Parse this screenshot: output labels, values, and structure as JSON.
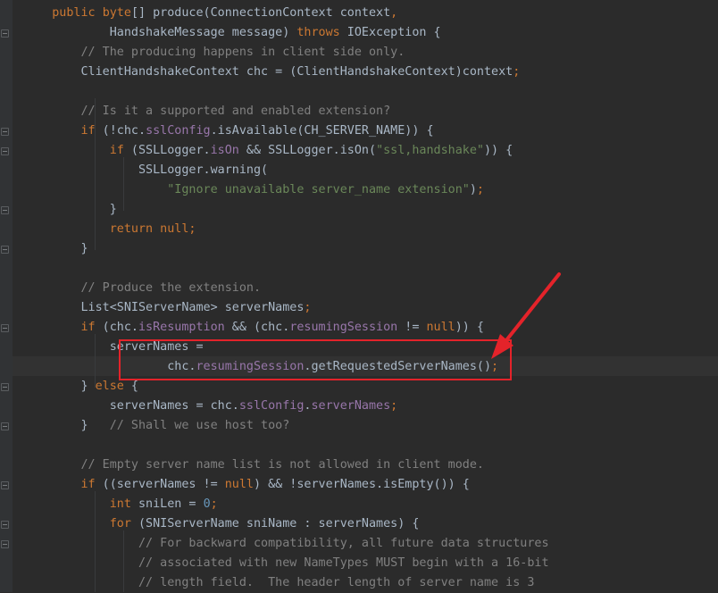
{
  "editor": {
    "lines": [
      [
        {
          "t": "    "
        },
        {
          "t": "public",
          "c": "k"
        },
        {
          "t": " "
        },
        {
          "t": "byte",
          "c": "k"
        },
        {
          "t": "[] produce(ConnectionContext context"
        },
        {
          "t": ",",
          "c": "k"
        }
      ],
      [
        {
          "t": "            HandshakeMessage message) "
        },
        {
          "t": "throws",
          "c": "k"
        },
        {
          "t": " IOException {"
        }
      ],
      [
        {
          "t": "        "
        },
        {
          "t": "// The producing happens in client side only.",
          "c": "c"
        }
      ],
      [
        {
          "t": "        ClientHandshakeContext chc = (ClientHandshakeContext)context"
        },
        {
          "t": ";",
          "c": "k"
        }
      ],
      [
        {
          "t": ""
        }
      ],
      [
        {
          "t": "        "
        },
        {
          "t": "// Is it a supported and enabled extension?",
          "c": "c"
        }
      ],
      [
        {
          "t": "        "
        },
        {
          "t": "if",
          "c": "k"
        },
        {
          "t": " (!chc."
        },
        {
          "t": "sslConfig",
          "c": "m"
        },
        {
          "t": ".isAvailable(CH_SERVER_NAME)) {"
        }
      ],
      [
        {
          "t": "            "
        },
        {
          "t": "if",
          "c": "k"
        },
        {
          "t": " (SSLLogger."
        },
        {
          "t": "isOn",
          "c": "m"
        },
        {
          "t": " && SSLLogger.isOn("
        },
        {
          "t": "\"ssl,handshake\"",
          "c": "s"
        },
        {
          "t": ")) {"
        }
      ],
      [
        {
          "t": "                SSLLogger.warning("
        }
      ],
      [
        {
          "t": "                    "
        },
        {
          "t": "\"Ignore unavailable server_name extension\"",
          "c": "s"
        },
        {
          "t": ")"
        },
        {
          "t": ";",
          "c": "k"
        }
      ],
      [
        {
          "t": "            }"
        }
      ],
      [
        {
          "t": "            "
        },
        {
          "t": "return null;",
          "c": "k"
        }
      ],
      [
        {
          "t": "        }"
        }
      ],
      [
        {
          "t": ""
        }
      ],
      [
        {
          "t": "        "
        },
        {
          "t": "// Produce the extension.",
          "c": "c"
        }
      ],
      [
        {
          "t": "        List<SNIServerName> serverNames"
        },
        {
          "t": ";",
          "c": "k"
        }
      ],
      [
        {
          "t": "        "
        },
        {
          "t": "if",
          "c": "k"
        },
        {
          "t": " (chc."
        },
        {
          "t": "isResumption",
          "c": "m"
        },
        {
          "t": " && (chc."
        },
        {
          "t": "resumingSession",
          "c": "m"
        },
        {
          "t": " != "
        },
        {
          "t": "null",
          "c": "k"
        },
        {
          "t": ")) {"
        }
      ],
      [
        {
          "t": "            serverNames ="
        }
      ],
      [
        {
          "t": "                    chc."
        },
        {
          "t": "resumingSession",
          "c": "m"
        },
        {
          "t": ".getRequestedServerNames()"
        },
        {
          "t": ";",
          "c": "k"
        }
      ],
      [
        {
          "t": "        } "
        },
        {
          "t": "else",
          "c": "k"
        },
        {
          "t": " {"
        }
      ],
      [
        {
          "t": "            serverNames = chc."
        },
        {
          "t": "sslConfig",
          "c": "m"
        },
        {
          "t": "."
        },
        {
          "t": "serverNames",
          "c": "m"
        },
        {
          "t": ";",
          "c": "k"
        }
      ],
      [
        {
          "t": "        }   "
        },
        {
          "t": "// Shall we use host too?",
          "c": "c"
        }
      ],
      [
        {
          "t": ""
        }
      ],
      [
        {
          "t": "        "
        },
        {
          "t": "// Empty server name list is not allowed in client mode.",
          "c": "c"
        }
      ],
      [
        {
          "t": "        "
        },
        {
          "t": "if",
          "c": "k"
        },
        {
          "t": " ((serverNames != "
        },
        {
          "t": "null",
          "c": "k"
        },
        {
          "t": ") && !serverNames.isEmpty()) {"
        }
      ],
      [
        {
          "t": "            "
        },
        {
          "t": "int",
          "c": "k"
        },
        {
          "t": " sniLen = "
        },
        {
          "t": "0",
          "c": "n"
        },
        {
          "t": ";",
          "c": "k"
        }
      ],
      [
        {
          "t": "            "
        },
        {
          "t": "for",
          "c": "k"
        },
        {
          "t": " (SNIServerName sniName : serverNames) {"
        }
      ],
      [
        {
          "t": "                "
        },
        {
          "t": "// For backward compatibility, all future data structures",
          "c": "c"
        }
      ],
      [
        {
          "t": "                "
        },
        {
          "t": "// associated with new NameTypes MUST begin with a 16-bit",
          "c": "c"
        }
      ],
      [
        {
          "t": "                "
        },
        {
          "t": "// length field.  The header length of server name is 3",
          "c": "c"
        }
      ]
    ]
  },
  "colors": {
    "background": "#2b2b2b",
    "keyword": "#cc7832",
    "comment": "#808080",
    "string": "#6a8759",
    "field": "#9876aa",
    "number": "#6897bb",
    "annotation": "#e4232a"
  },
  "icons": [
    "fold-marker-icon",
    "red-arrow-annotation-icon"
  ]
}
